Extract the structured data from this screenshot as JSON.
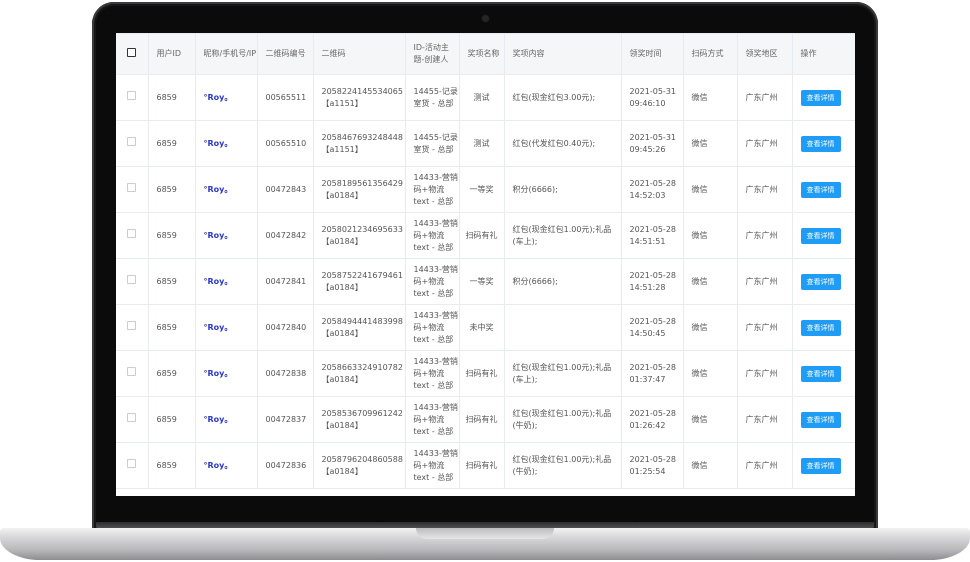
{
  "table": {
    "headers": {
      "user_id": "用户ID",
      "nickname": "昵称/手机号/IP",
      "qr_no": "二维码编号",
      "qr_code": "二维码",
      "activity": "ID-活动主题-创建人",
      "prize_name": "奖项名称",
      "prize_content": "奖项内容",
      "win_time": "领奖时间",
      "scan_method": "扫码方式",
      "region": "领奖地区",
      "action": "操作"
    },
    "rows": [
      {
        "user_id": "6859",
        "nickname": "°Roy。",
        "qr_no": "00565511",
        "qr_code": "2058224145534065【a1151】",
        "activity": "14455-记录室货 - 总部",
        "prize_name": "测试",
        "prize_content": "红包(现金红包3.00元);",
        "win_time": "2021-05-31 09:46:10",
        "scan_method": "微信",
        "region": "广东广州",
        "action": "查看详情"
      },
      {
        "user_id": "6859",
        "nickname": "°Roy。",
        "qr_no": "00565510",
        "qr_code": "2058467693248448【a1151】",
        "activity": "14455-记录室货 - 总部",
        "prize_name": "测试",
        "prize_content": "红包(代发红包0.40元);",
        "win_time": "2021-05-31 09:45:26",
        "scan_method": "微信",
        "region": "广东广州",
        "action": "查看详情"
      },
      {
        "user_id": "6859",
        "nickname": "°Roy。",
        "qr_no": "00472843",
        "qr_code": "2058189561356429【a0184】",
        "activity": "14433-营销码+物流text - 总部",
        "prize_name": "一等奖",
        "prize_content": "积分(6666);",
        "win_time": "2021-05-28 14:52:03",
        "scan_method": "微信",
        "region": "广东广州",
        "action": "查看详情"
      },
      {
        "user_id": "6859",
        "nickname": "°Roy。",
        "qr_no": "00472842",
        "qr_code": "2058021234695633【a0184】",
        "activity": "14433-营销码+物流text - 总部",
        "prize_name": "扫码有礼",
        "prize_content": "红包(现金红包1.00元);礼品(车上);",
        "win_time": "2021-05-28 14:51:51",
        "scan_method": "微信",
        "region": "广东广州",
        "action": "查看详情"
      },
      {
        "user_id": "6859",
        "nickname": "°Roy。",
        "qr_no": "00472841",
        "qr_code": "2058752241679461【a0184】",
        "activity": "14433-营销码+物流text - 总部",
        "prize_name": "一等奖",
        "prize_content": "积分(6666);",
        "win_time": "2021-05-28 14:51:28",
        "scan_method": "微信",
        "region": "广东广州",
        "action": "查看详情"
      },
      {
        "user_id": "6859",
        "nickname": "°Roy。",
        "qr_no": "00472840",
        "qr_code": "2058494441483998【a0184】",
        "activity": "14433-营销码+物流text - 总部",
        "prize_name": "未中奖",
        "prize_content": "",
        "win_time": "2021-05-28 14:50:45",
        "scan_method": "微信",
        "region": "广东广州",
        "action": "查看详情"
      },
      {
        "user_id": "6859",
        "nickname": "°Roy。",
        "qr_no": "00472838",
        "qr_code": "2058663324910782【a0184】",
        "activity": "14433-营销码+物流text - 总部",
        "prize_name": "扫码有礼",
        "prize_content": "红包(现金红包1.00元);礼品(车上);",
        "win_time": "2021-05-28 01:37:47",
        "scan_method": "微信",
        "region": "广东广州",
        "action": "查看详情"
      },
      {
        "user_id": "6859",
        "nickname": "°Roy。",
        "qr_no": "00472837",
        "qr_code": "2058536709961242【a0184】",
        "activity": "14433-营销码+物流text - 总部",
        "prize_name": "扫码有礼",
        "prize_content": "红包(现金红包1.00元);礼品(牛奶);",
        "win_time": "2021-05-28 01:26:42",
        "scan_method": "微信",
        "region": "广东广州",
        "action": "查看详情"
      },
      {
        "user_id": "6859",
        "nickname": "°Roy。",
        "qr_no": "00472836",
        "qr_code": "2058796204860588【a0184】",
        "activity": "14433-营销码+物流text - 总部",
        "prize_name": "扫码有礼",
        "prize_content": "红包(现金红包1.00元);礼品(牛奶);",
        "win_time": "2021-05-28 01:25:54",
        "scan_method": "微信",
        "region": "广东广州",
        "action": "查看详情"
      }
    ]
  }
}
